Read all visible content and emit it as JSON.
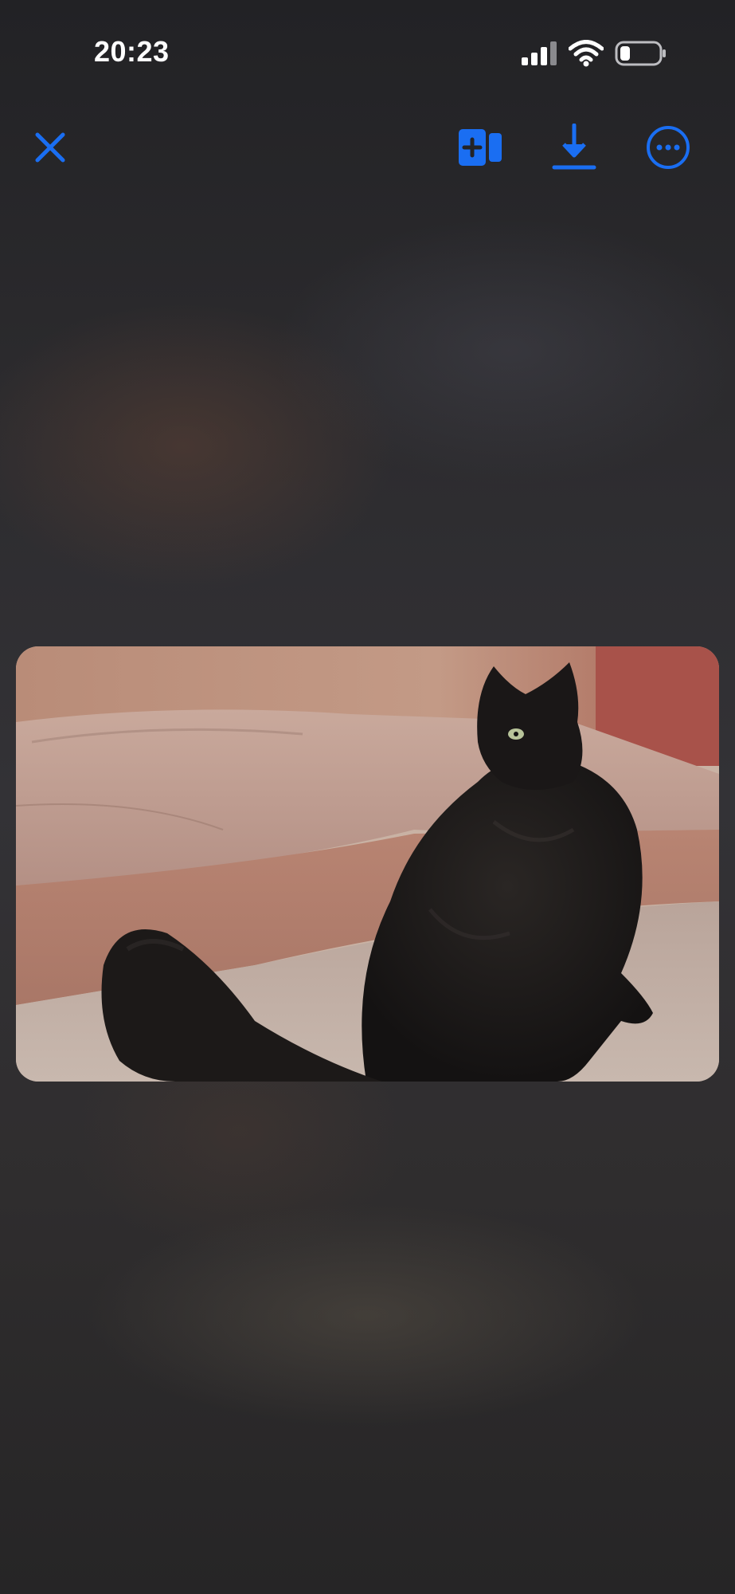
{
  "status_bar": {
    "time": "20:23",
    "signal_icon": "cellular-signal-icon",
    "wifi_icon": "wifi-icon",
    "battery_icon": "battery-icon",
    "battery_level": 0.25
  },
  "toolbar": {
    "close_icon": "close-icon",
    "add_icon": "add-to-album-icon",
    "download_icon": "download-icon",
    "more_icon": "more-options-icon"
  },
  "colors": {
    "accent": "#1a6ef2",
    "text": "#ffffff",
    "background": "#2a2a2c"
  },
  "photo": {
    "subject": "black-cat-photo"
  }
}
